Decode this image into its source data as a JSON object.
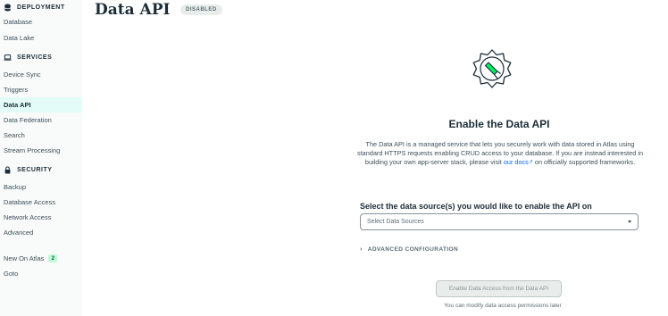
{
  "sidebar": {
    "deployment": {
      "title": "DEPLOYMENT",
      "items": [
        {
          "label": "Database"
        },
        {
          "label": "Data Lake"
        }
      ]
    },
    "services": {
      "title": "SERVICES",
      "items": [
        {
          "label": "Device Sync"
        },
        {
          "label": "Triggers"
        },
        {
          "label": "Data API"
        },
        {
          "label": "Data Federation"
        },
        {
          "label": "Search"
        },
        {
          "label": "Stream Processing"
        }
      ]
    },
    "security": {
      "title": "SECURITY",
      "items": [
        {
          "label": "Backup"
        },
        {
          "label": "Database Access"
        },
        {
          "label": "Network Access"
        },
        {
          "label": "Advanced"
        }
      ]
    },
    "extra": {
      "new_on_atlas": "New On Atlas",
      "new_count": "2",
      "goto": "Goto"
    },
    "active": "Data API"
  },
  "header": {
    "title": "Data API",
    "status": "DISABLED"
  },
  "content": {
    "heading": "Enable the Data API",
    "description_part1": "The Data API is a managed service that lets you securely work with data stored in Atlas using standard HTTPS requests enabling CRUD access to your database. If you are instead interested in building your own app-server stack, please visit",
    "docs_link": "our docs",
    "description_part2": "on officially supported frameworks.",
    "select_label": "Select the data source(s) you would like to enable the API on",
    "select_placeholder": "Select Data Sources",
    "advanced_label": "ADVANCED CONFIGURATION",
    "enable_button": "Enable Data Access from the Data API",
    "note": "You can modify data access permissions later"
  },
  "colors": {
    "accent": "#00684a",
    "active_bg": "#e3fcf7",
    "link": "#016bf8"
  }
}
